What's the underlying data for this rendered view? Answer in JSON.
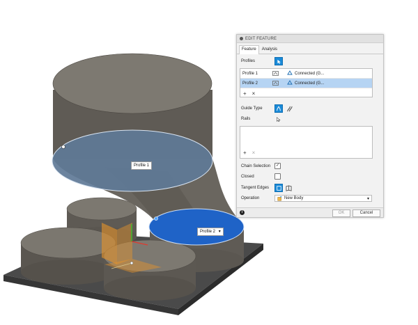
{
  "canvas": {
    "profile1_label": "Profile 1",
    "profile2_label": "Profile 2",
    "profile2_caret": "▾"
  },
  "panel": {
    "title": "EDIT FEATURE",
    "tabs": [
      "Feature",
      "Analysis"
    ],
    "profiles_label": "Profiles",
    "profiles": [
      {
        "name": "Profile 1",
        "status": "Connected (G..."
      },
      {
        "name": "Profile 2",
        "status": "Connected (G..."
      }
    ],
    "guide_type_label": "Guide Type",
    "rails_label": "Rails",
    "chain_selection_label": "Chain Selection",
    "chain_selection_checked": true,
    "closed_label": "Closed",
    "closed_checked": false,
    "tangent_edges_label": "Tangent Edges",
    "operation_label": "Operation",
    "operation_value": "New Body",
    "ok_label": "OK",
    "cancel_label": "Cancel",
    "info_glyph": "i",
    "add_glyph": "+",
    "remove_glyph": "×",
    "check_glyph": "✓",
    "caret_glyph": "▾"
  },
  "colors": {
    "accent_blue": "#1a8ad8",
    "selected_row": "#b6d4f3",
    "annotation_red": "#d42a1e",
    "profile2_fill": "#1f63c7",
    "profile1_fill": "#5f7a97"
  }
}
